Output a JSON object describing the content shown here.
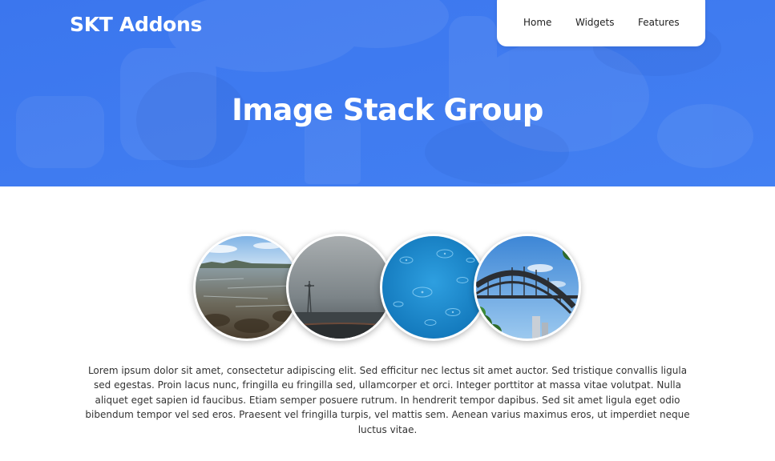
{
  "header": {
    "brand": "SKT Addons",
    "nav": {
      "home": "Home",
      "widgets": "Widgets",
      "features": "Features"
    },
    "title": "Image Stack Group"
  },
  "colors": {
    "hero_blue": "#3e7bf0",
    "text_dark": "#333333",
    "white": "#ffffff"
  },
  "images": [
    {
      "subject": "rocky shoreline with shallow water"
    },
    {
      "subject": "foggy field with windmill"
    },
    {
      "subject": "blue water with rain ripples"
    },
    {
      "subject": "arched steel bridge against blue sky"
    }
  ],
  "description": "Lorem ipsum dolor sit amet, consectetur adipiscing elit. Sed efficitur nec lectus sit amet auctor. Sed tristique convallis ligula sed egestas. Proin lacus nunc, fringilla eu fringilla sed, ullamcorper et orci. Integer porttitor at massa vitae volutpat. Nulla aliquet eget sapien id faucibus. Etiam semper posuere rutrum. In hendrerit tempor dapibus. Sed sit amet ligula eget odio bibendum tempor vel sed eros. Praesent vel fringilla turpis, vel mattis sem. Aenean varius maximus eros, ut imperdiet neque luctus vitae."
}
